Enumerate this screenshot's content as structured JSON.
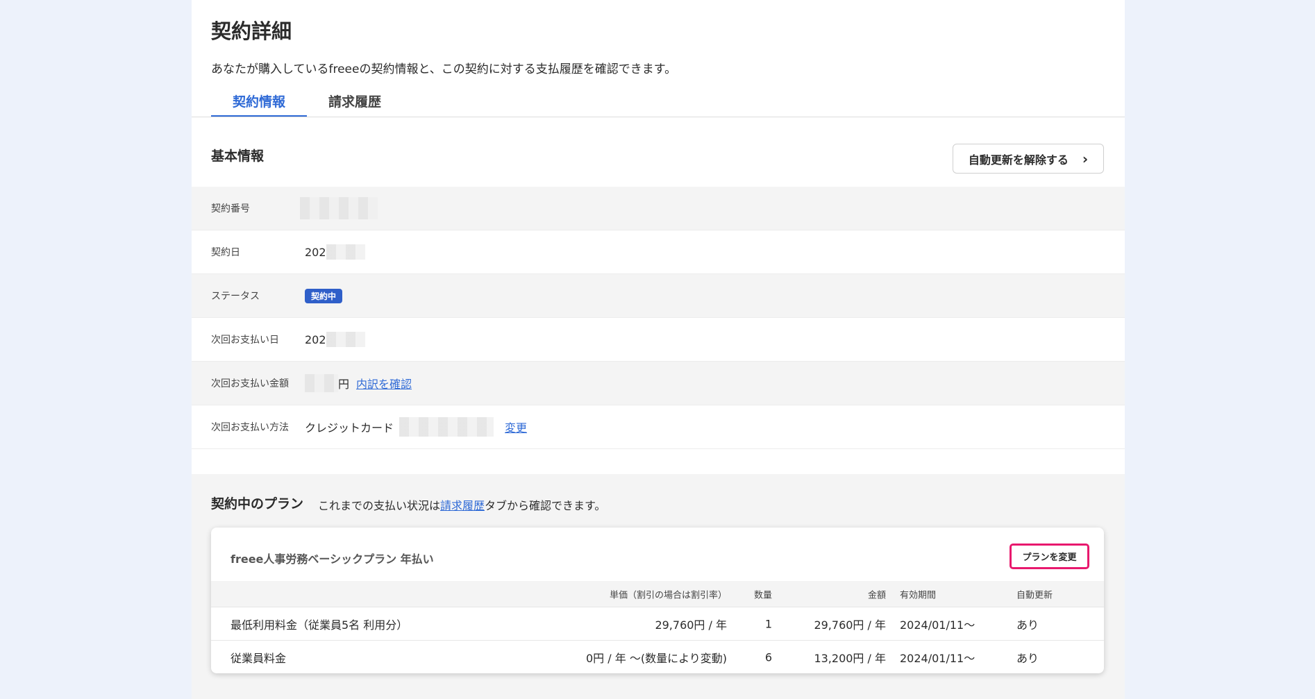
{
  "header": {
    "title": "契約詳細",
    "description": "あなたが購入しているfreeeの契約情報と、この契約に対する支払履歴を確認できます。"
  },
  "tabs": [
    {
      "label": "契約情報",
      "active": true
    },
    {
      "label": "請求履歴",
      "active": false
    }
  ],
  "basic_info": {
    "heading": "基本情報",
    "renew_button_label": "自動更新を解除する",
    "rows": {
      "contract_number": {
        "label": "契約番号"
      },
      "contract_date": {
        "label": "契約日",
        "value": "202"
      },
      "status": {
        "label": "ステータス",
        "badge": "契約中"
      },
      "next_payment_date": {
        "label": "次回お支払い日",
        "value": "202"
      },
      "next_payment_amount": {
        "label": "次回お支払い金額",
        "suffix": "円",
        "link": "内訳を確認"
      },
      "payment_method": {
        "label": "次回お支払い方法",
        "value": "クレジットカード",
        "link": "変更"
      }
    }
  },
  "plans": {
    "heading": "契約中のプラン",
    "note_prefix": "これまでの支払い状況は",
    "note_link": "請求履歴",
    "note_suffix": "タブから確認できます。",
    "card": {
      "title": "freee人事労務ベーシックプラン 年払い",
      "change_button_label": "プランを変更",
      "columns": {
        "unit_price": "単価（割引の場合は割引率）",
        "quantity": "数量",
        "amount": "金額",
        "period": "有効期間",
        "auto_renew": "自動更新"
      },
      "items": [
        {
          "name": "最低利用料金（従業員5名 利用分）",
          "unit_price": "29,760円 / 年",
          "quantity": "1",
          "amount": "29,760円 / 年",
          "period": "2024/01/11〜",
          "auto_renew": "あり"
        },
        {
          "name": "従業員料金",
          "unit_price": "0円 / 年 〜(数量により変動)",
          "quantity": "6",
          "amount": "13,200円 / 年",
          "period": "2024/01/11〜",
          "auto_renew": "あり"
        }
      ]
    }
  },
  "colors": {
    "accent": "#2f6ad6",
    "badge": "#2f5fc9",
    "highlight_border": "#e8186d",
    "background": "#edf2fb"
  }
}
